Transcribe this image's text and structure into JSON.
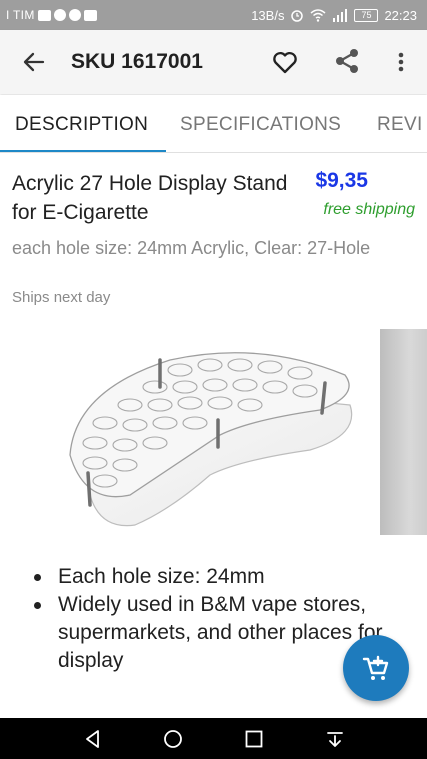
{
  "status_bar": {
    "carrier": "I TIM",
    "net_speed": "13B/s",
    "battery": "75",
    "time": "22:23",
    "icons": [
      "mail-icon",
      "telegram-icon",
      "skype-icon",
      "youtube-icon",
      "alarm-icon",
      "wifi-icon",
      "signal-icon",
      "battery-icon"
    ]
  },
  "app_bar": {
    "title": "SKU 1617001",
    "icons": [
      "back-arrow-icon",
      "heart-outline-icon",
      "share-icon",
      "more-vert-icon"
    ]
  },
  "tabs": [
    {
      "label": "DESCRIPTION",
      "active": true
    },
    {
      "label": "SPECIFICATIONS",
      "active": false
    },
    {
      "label": "REVI",
      "active": false
    }
  ],
  "product": {
    "title": "Acrylic 27 Hole Display Stand for E-Cigarette",
    "price": "$9,35",
    "shipping": "free shipping",
    "subtitle": "each hole size: 24mm Acrylic, Clear: 27-Hole",
    "availability": "Ships next day"
  },
  "bullets": [
    "Each hole size: 24mm",
    "Widely used in B&M vape stores, supermarkets, and other places for display"
  ],
  "fab": {
    "icon": "add-to-cart-icon"
  },
  "nav_bar": {
    "icons": [
      "nav-back-icon",
      "nav-home-icon",
      "nav-recents-icon",
      "nav-notifications-icon"
    ]
  },
  "colors": {
    "accent": "#1e88c7",
    "price": "#1a37e6",
    "shipping": "#2e9e2e",
    "fab": "#1e7bbd",
    "status_bar": "#9e9e9e",
    "app_bar": "#f5f5f5"
  }
}
